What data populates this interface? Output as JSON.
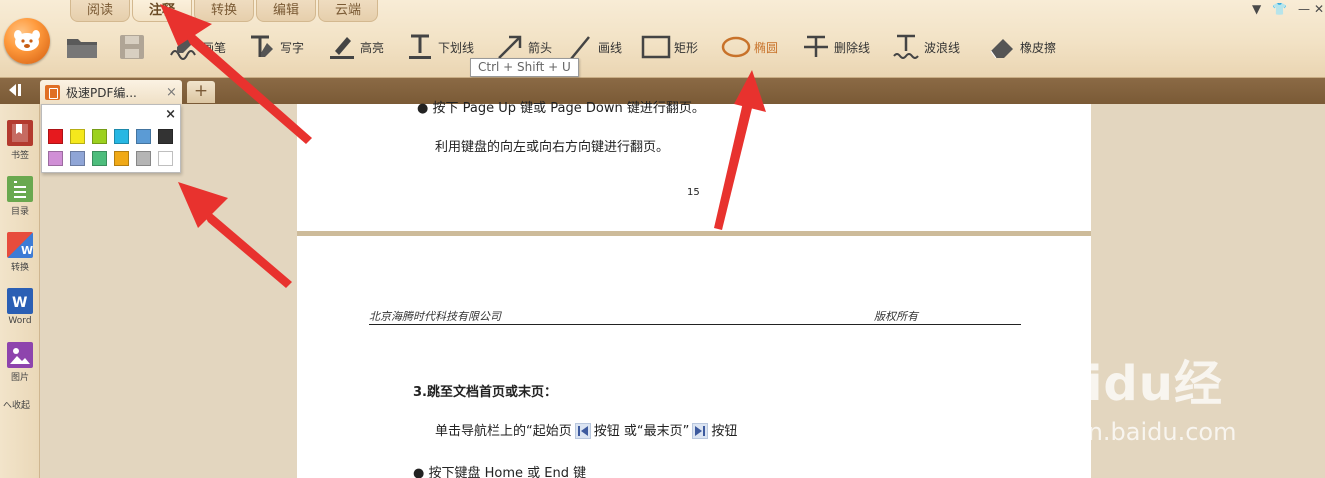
{
  "menu_tabs": [
    "阅读",
    "注释",
    "转换",
    "编辑",
    "云端"
  ],
  "toolbar": {
    "tools": [
      {
        "label": "画笔",
        "icon": "pen-icon"
      },
      {
        "label": "写字",
        "icon": "text-tool-icon"
      },
      {
        "label": "高亮",
        "icon": "highlight-icon"
      },
      {
        "label": "下划线",
        "icon": "underline-icon"
      },
      {
        "label": "箭头",
        "icon": "arrow-icon"
      },
      {
        "label": "画线",
        "icon": "line-icon"
      },
      {
        "label": "矩形",
        "icon": "rectangle-icon"
      },
      {
        "label": "椭圆",
        "icon": "ellipse-icon"
      },
      {
        "label": "删除线",
        "icon": "strikethrough-icon"
      },
      {
        "label": "波浪线",
        "icon": "wavy-line-icon"
      },
      {
        "label": "橡皮擦",
        "icon": "eraser-icon"
      }
    ],
    "selected_tool": "椭圆",
    "tooltip": "Ctrl + Shift + U"
  },
  "tabs": {
    "document_tab": "极速PDF编...",
    "close_glyph": "×",
    "new_tab_glyph": "+"
  },
  "sidebar": {
    "items": [
      {
        "label": "书签",
        "icon": "bookmark-icon",
        "color": "#c0392b"
      },
      {
        "label": "目录",
        "icon": "toc-icon",
        "color": "#6aa84f"
      },
      {
        "label": "转换",
        "icon": "convert-icon",
        "color": "#e74c3c"
      },
      {
        "label": "Word",
        "icon": "word-icon",
        "color": "#2b5fb4"
      },
      {
        "label": "图片",
        "icon": "image-icon",
        "color": "#8e44ad"
      }
    ],
    "fold_label": "へ收起"
  },
  "color_picker": {
    "close_glyph": "×",
    "colors": [
      [
        "#e6191e",
        "#f5e81c",
        "#9cd11f",
        "#27b7e3",
        "#5b9bd5",
        "#333333"
      ],
      [
        "#d08fd6",
        "#8fa5d6",
        "#4dbd7c",
        "#f0a916",
        "#b5b5b5",
        "#ffffff"
      ]
    ]
  },
  "page15": {
    "bullet_text": "按下 Page Up 键或 Page Down 键进行翻页。",
    "text": "利用键盘的向左或向右方向键进行翻页。",
    "page_number": "15"
  },
  "page16": {
    "header_left": "北京海腾时代科技有限公司",
    "header_right": "版权所有",
    "heading": "3.跳至文档首页或末页：",
    "line1_a": "单击导航栏上的“起始页",
    "line1_b": "按钮 或“最末页”",
    "line1_c": "按钮",
    "bullet": "按下键盘 Home 或 End 键"
  },
  "watermark": {
    "brand": "Baidu经验",
    "sub": "jingyan.baidu.com"
  },
  "window_controls": [
    "▼",
    "👕",
    "—",
    "✕"
  ]
}
